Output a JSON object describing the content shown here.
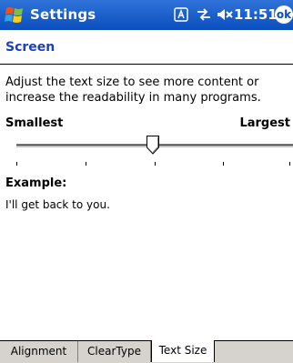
{
  "titlebar": {
    "app_title": "Settings",
    "time": "11:51",
    "ok_label": "ok"
  },
  "page": {
    "title": "Screen",
    "description": "Adjust the text size to see more content or increase the readability in many programs."
  },
  "slider": {
    "min_label": "Smallest",
    "max_label": "Largest",
    "position": 2,
    "steps": 5
  },
  "example": {
    "label": "Example:",
    "text": "I'll get back to you."
  },
  "tabs": [
    {
      "label": "Alignment",
      "selected": false
    },
    {
      "label": "ClearType",
      "selected": false
    },
    {
      "label": "Text Size",
      "selected": true
    }
  ],
  "colors": {
    "titlebar": "#0b4fbf",
    "page_title": "#1a3fbf",
    "tabbar": "#d6d3ce"
  },
  "icons": [
    "windows-start-icon",
    "input-method-icon",
    "connectivity-icon",
    "volume-muted-icon"
  ]
}
